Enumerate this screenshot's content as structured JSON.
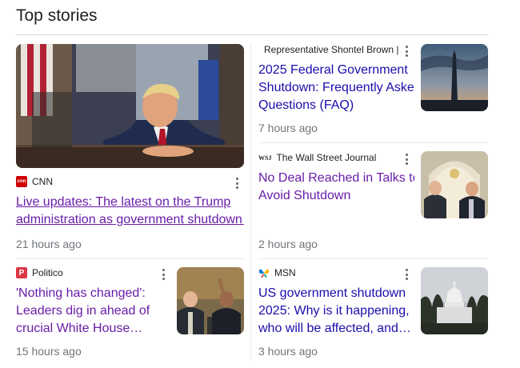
{
  "heading": "Top stories",
  "stories": [
    {
      "source": "CNN",
      "logo_icon": "cnn-logo-icon",
      "title_lines": [
        "Live updates: The latest on the Trump",
        "administration as government shutdown…"
      ],
      "time": "21 hours ago"
    },
    {
      "source": "Representative Shontel Brown | (.gov)",
      "title_lines": [
        "2025 Federal Government",
        "Shutdown: Frequently Asked",
        "Questions (FAQ)"
      ],
      "time": "7 hours ago"
    },
    {
      "source": "The Wall Street Journal",
      "logo_text": "WSJ",
      "title_lines": [
        "No Deal Reached in Talks to",
        "Avoid Shutdown"
      ],
      "time": "2 hours ago"
    },
    {
      "source": "Politico",
      "logo_text": "P",
      "title_lines": [
        "'Nothing has changed':",
        "Leaders dig in ahead of",
        "crucial White House…"
      ],
      "time": "15 hours ago"
    },
    {
      "source": "MSN",
      "logo_icon": "msn-butterfly-icon",
      "title_lines": [
        "US government shutdown",
        "2025: Why is it happening,",
        "who will be affected, and…"
      ],
      "time": "3 hours ago"
    }
  ],
  "colors": {
    "link": "#1a0dab",
    "visited_link": "#681da8",
    "cnn_red": "#cc0000",
    "politico_red": "#dc3545",
    "meta_gray": "#70757a"
  }
}
